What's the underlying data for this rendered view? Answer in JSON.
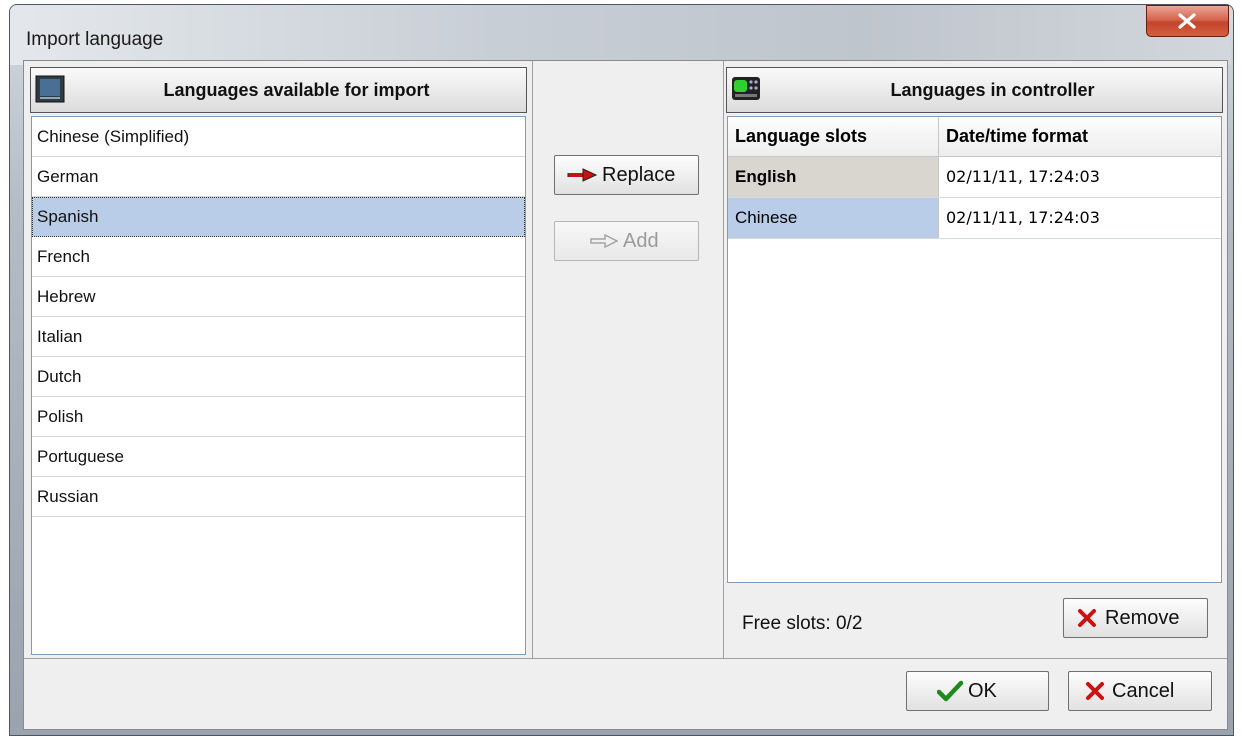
{
  "window": {
    "title": "Import language",
    "close_glyph": "X"
  },
  "left_panel": {
    "header": "Languages available for import",
    "header_icon": "monitor-icon",
    "items": [
      {
        "label": "Chinese (Simplified)",
        "selected": false
      },
      {
        "label": "German",
        "selected": false
      },
      {
        "label": "Spanish",
        "selected": true
      },
      {
        "label": "French",
        "selected": false
      },
      {
        "label": "Hebrew",
        "selected": false
      },
      {
        "label": "Italian",
        "selected": false
      },
      {
        "label": "Dutch",
        "selected": false
      },
      {
        "label": "Polish",
        "selected": false
      },
      {
        "label": "Portuguese",
        "selected": false
      },
      {
        "label": "Russian",
        "selected": false
      }
    ]
  },
  "middle_panel": {
    "replace_label": "Replace",
    "replace_icon": "red-arrow-right-icon",
    "add_label": "Add",
    "add_icon": "outline-arrow-right-icon",
    "add_enabled": false
  },
  "right_panel": {
    "header": "Languages in controller",
    "header_icon": "controller-device-icon",
    "columns": [
      "Language slots",
      "Date/time format"
    ],
    "rows": [
      {
        "slot": "English",
        "datetime": "02/11/11, 17:24:03",
        "state": "active"
      },
      {
        "slot": "Chinese",
        "datetime": "02/11/11, 17:24:03",
        "state": "selected"
      }
    ],
    "free_slots": "Free slots: 0/2",
    "remove_label": "Remove",
    "remove_icon": "red-x-icon"
  },
  "footer": {
    "ok_label": "OK",
    "ok_icon": "green-check-icon",
    "cancel_label": "Cancel",
    "cancel_icon": "red-x-icon"
  },
  "colors": {
    "selection": "#b9cde8",
    "active_slot": "#d9d6d0",
    "close_button": "#c2442b",
    "check_green": "#1d8a1d",
    "x_red": "#cc1111"
  }
}
